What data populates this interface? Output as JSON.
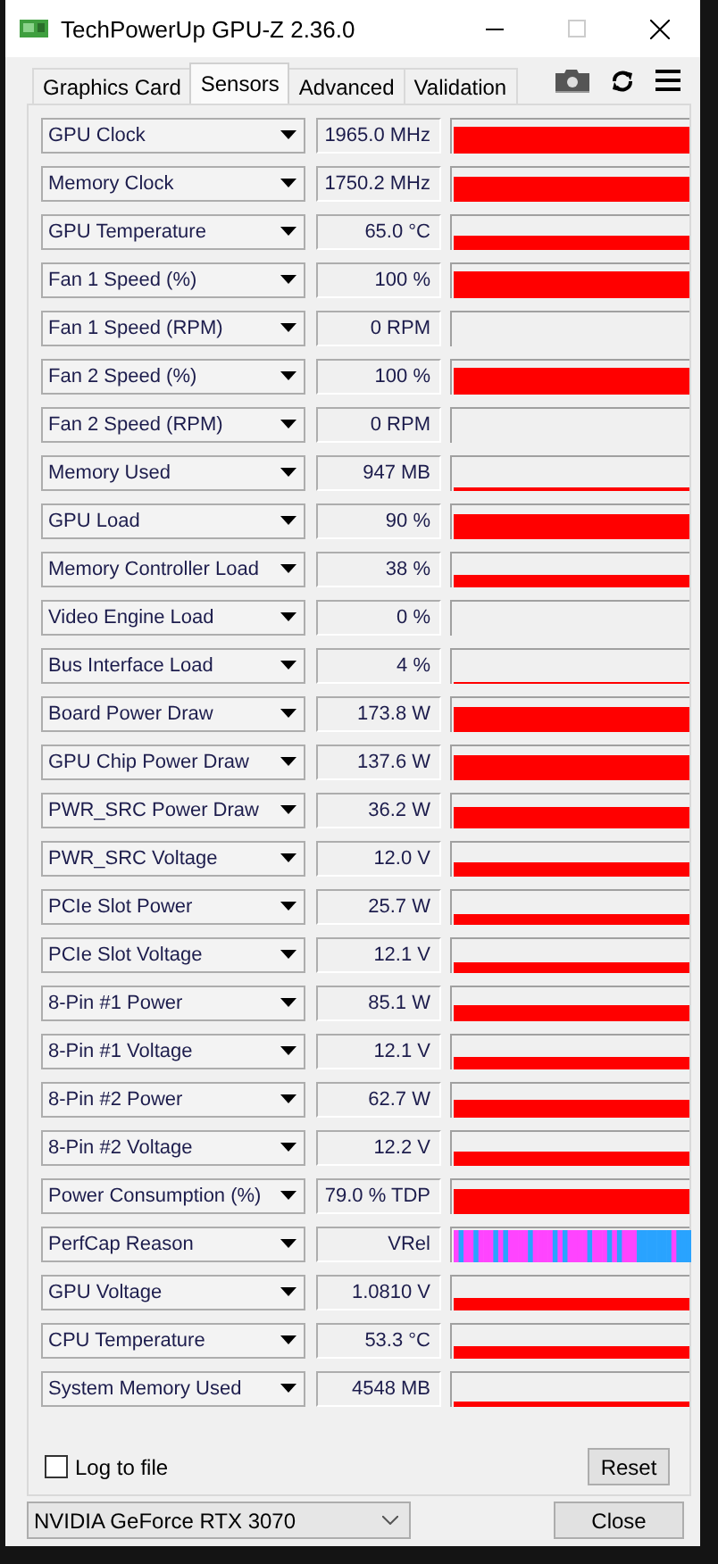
{
  "window": {
    "title": "TechPowerUp GPU-Z 2.36.0"
  },
  "tabs": [
    {
      "label": "Graphics Card",
      "selected": false
    },
    {
      "label": "Sensors",
      "selected": true
    },
    {
      "label": "Advanced",
      "selected": false
    },
    {
      "label": "Validation",
      "selected": false
    }
  ],
  "sensors": [
    {
      "name": "GPU Clock",
      "value": "1965.0 MHz",
      "kind": "bar"
    },
    {
      "name": "Memory Clock",
      "value": "1750.2 MHz",
      "kind": "bar"
    },
    {
      "name": "GPU Temperature",
      "value": "65.0 °C",
      "kind": "bar"
    },
    {
      "name": "Fan 1 Speed (%)",
      "value": "100 %",
      "kind": "bar"
    },
    {
      "name": "Fan 1 Speed (RPM)",
      "value": "0 RPM",
      "kind": "bar"
    },
    {
      "name": "Fan 2 Speed (%)",
      "value": "100 %",
      "kind": "bar"
    },
    {
      "name": "Fan 2 Speed (RPM)",
      "value": "0 RPM",
      "kind": "bar"
    },
    {
      "name": "Memory Used",
      "value": "947 MB",
      "kind": "bar"
    },
    {
      "name": "GPU Load",
      "value": "90 %",
      "kind": "bar"
    },
    {
      "name": "Memory Controller Load",
      "value": "38 %",
      "kind": "bar"
    },
    {
      "name": "Video Engine Load",
      "value": "0 %",
      "kind": "bar"
    },
    {
      "name": "Bus Interface Load",
      "value": "4 %",
      "kind": "bar"
    },
    {
      "name": "Board Power Draw",
      "value": "173.8 W",
      "kind": "bar"
    },
    {
      "name": "GPU Chip Power Draw",
      "value": "137.6 W",
      "kind": "bar"
    },
    {
      "name": "PWR_SRC Power Draw",
      "value": "36.2 W",
      "kind": "bar"
    },
    {
      "name": "PWR_SRC Voltage",
      "value": "12.0 V",
      "kind": "bar"
    },
    {
      "name": "PCIe Slot Power",
      "value": "25.7 W",
      "kind": "bar"
    },
    {
      "name": "PCIe Slot Voltage",
      "value": "12.1 V",
      "kind": "bar"
    },
    {
      "name": "8-Pin #1 Power",
      "value": "85.1 W",
      "kind": "bar"
    },
    {
      "name": "8-Pin #1 Voltage",
      "value": "12.1 V",
      "kind": "bar"
    },
    {
      "name": "8-Pin #2 Power",
      "value": "62.7 W",
      "kind": "bar"
    },
    {
      "name": "8-Pin #2 Voltage",
      "value": "12.2 V",
      "kind": "bar"
    },
    {
      "name": "Power Consumption (%)",
      "value": "79.0 % TDP",
      "kind": "bar"
    },
    {
      "name": "PerfCap Reason",
      "value": "VRel",
      "kind": "perfcap"
    },
    {
      "name": "GPU Voltage",
      "value": "1.0810 V",
      "kind": "bar"
    },
    {
      "name": "CPU Temperature",
      "value": "53.3 °C",
      "kind": "bar"
    },
    {
      "name": "System Memory Used",
      "value": "4548 MB",
      "kind": "bar"
    }
  ],
  "log_to_file": {
    "label": "Log to file",
    "checked": false
  },
  "reset_button": "Reset",
  "gpu_select": {
    "value": "NVIDIA GeForce RTX 3070"
  },
  "close_button": "Close"
}
